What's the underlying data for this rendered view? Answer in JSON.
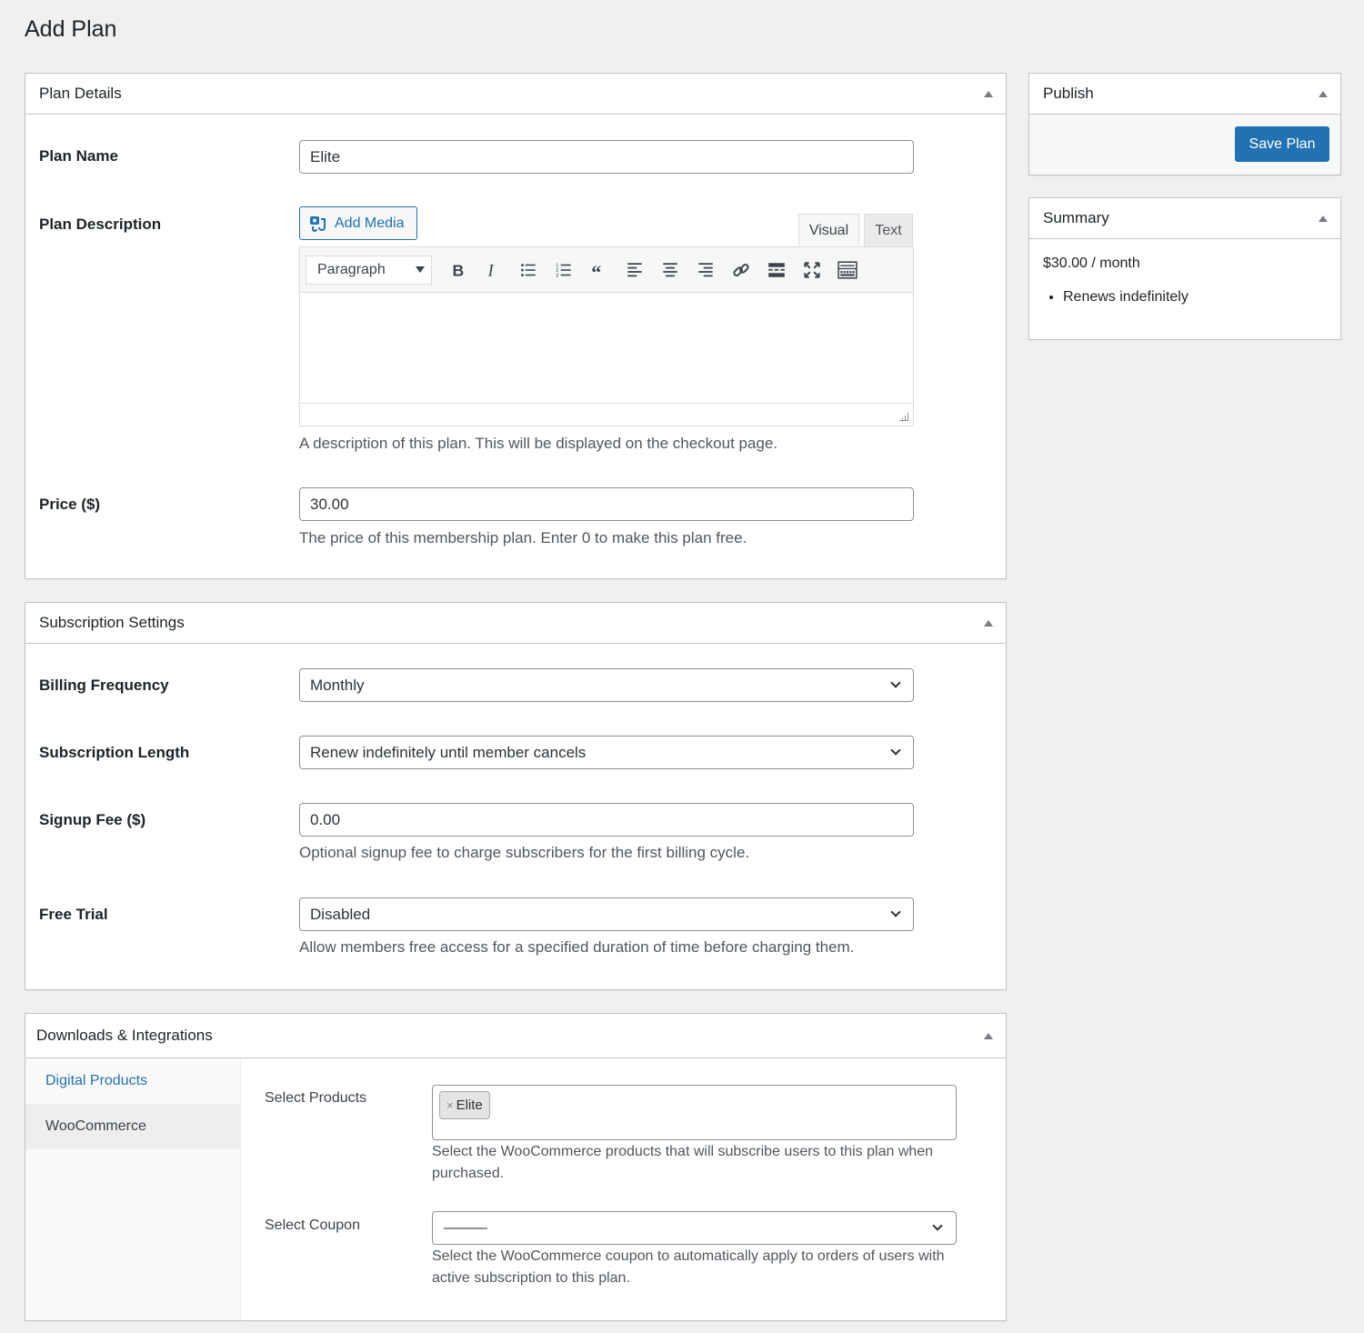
{
  "page": {
    "title": "Add Plan"
  },
  "plan_details": {
    "title": "Plan Details",
    "plan_name": {
      "label": "Plan Name",
      "value": "Elite"
    },
    "plan_description": {
      "label": "Plan Description",
      "add_media_label": "Add Media",
      "tabs": [
        {
          "label": "Visual",
          "active": true
        },
        {
          "label": "Text",
          "active": false
        }
      ],
      "format_select": "Paragraph",
      "toolbar": [
        {
          "icon": "bold-icon"
        },
        {
          "icon": "italic-icon"
        },
        {
          "icon": "bulleted-list-icon"
        },
        {
          "icon": "numbered-list-icon"
        },
        {
          "icon": "blockquote-icon"
        },
        {
          "icon": "align-left-icon"
        },
        {
          "icon": "align-center-icon"
        },
        {
          "icon": "align-right-icon"
        },
        {
          "icon": "link-icon"
        },
        {
          "icon": "read-more-icon"
        },
        {
          "icon": "fullscreen-icon"
        },
        {
          "icon": "toolbar-toggle-icon"
        }
      ],
      "content": "",
      "help": "A description of this plan. This will be displayed on the checkout page."
    },
    "price": {
      "label": "Price ($)",
      "value": "30.00",
      "help": "The price of this membership plan. Enter 0 to make this plan free."
    }
  },
  "subscription_settings": {
    "title": "Subscription Settings",
    "billing_frequency": {
      "label": "Billing Frequency",
      "value": "Monthly"
    },
    "subscription_length": {
      "label": "Subscription Length",
      "value": "Renew indefinitely until member cancels"
    },
    "signup_fee": {
      "label": "Signup Fee ($)",
      "value": "0.00",
      "help": "Optional signup fee to charge subscribers for the first billing cycle."
    },
    "free_trial": {
      "label": "Free Trial",
      "value": "Disabled",
      "help": "Allow members free access for a specified duration of time before charging them."
    }
  },
  "downloads_integrations": {
    "title": "Downloads & Integrations",
    "tabs": [
      {
        "label": "Digital Products",
        "active": true
      },
      {
        "label": "WooCommerce",
        "active": false
      }
    ],
    "select_products": {
      "label": "Select Products",
      "selected": [
        "Elite"
      ],
      "help": "Select the WooCommerce products that will subscribe users to this plan when purchased."
    },
    "select_coupon": {
      "label": "Select Coupon",
      "value": "———",
      "help": "Select the WooCommerce coupon to automatically apply to orders of users with active subscription to this plan."
    }
  },
  "publish": {
    "title": "Publish",
    "save_label": "Save Plan"
  },
  "summary": {
    "title": "Summary",
    "price_line": "$30.00 / month",
    "items": [
      "Renews indefinitely"
    ]
  },
  "colors": {
    "primary": "#2271b1",
    "background": "#f0f0f1",
    "border": "#c3c4c7"
  }
}
